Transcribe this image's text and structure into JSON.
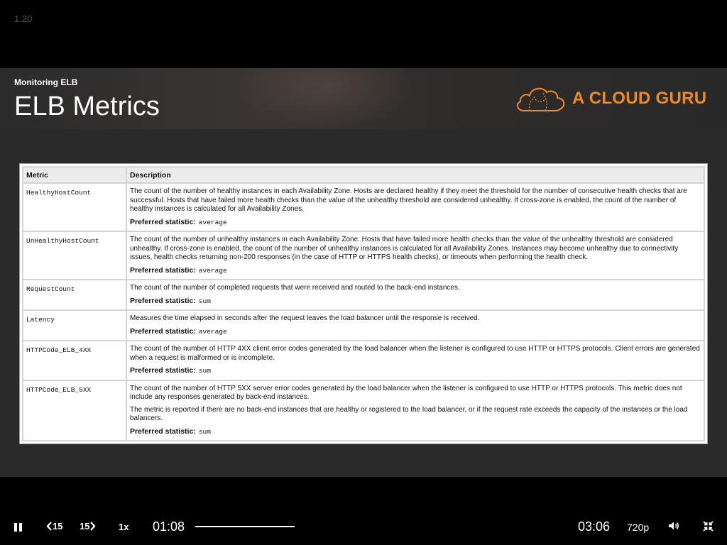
{
  "player": {
    "version": "1.20",
    "skip_back_label": "15",
    "skip_forward_label": "15",
    "speed": "1x",
    "current_time": "01:08",
    "duration": "03:06",
    "quality": "720p",
    "progress_fraction": 0.367
  },
  "slide": {
    "subtitle": "Monitoring ELB",
    "title": "ELB Metrics",
    "logo_text": "A CLOUD GURU",
    "brand_color": "#f08a24",
    "table": {
      "headers": [
        "Metric",
        "Description"
      ],
      "stat_label": "Preferred statistic:",
      "rows": [
        {
          "metric": "HealthyHostCount",
          "desc": "The count of the number of healthy instances in each Availability Zone. Hosts are declared healthy if they meet the threshold for the number of consecutive health checks that are successful. Hosts that have failed more health checks than the value of the unhealthy threshold are considered unhealthy. If cross-zone is enabled, the count of the number of healthy instances is calculated for all Availability Zones.",
          "desc2": "",
          "stat": "average"
        },
        {
          "metric": "UnHealthyHostCount",
          "desc": "The count of the number of unhealthy instances in each Availability Zone. Hosts that have failed more health checks than the value of the unhealthy threshold are considered unhealthy. If cross-zone is enabled, the count of the number of unhealthy instances is calculated for all Availability Zones. Instances may become unhealthy due to connectivity issues, health checks returning non-200 responses (in the case of HTTP or HTTPS health checks), or timeouts when performing the health check.",
          "desc2": "",
          "stat": "average"
        },
        {
          "metric": "RequestCount",
          "desc": "The count of the number of completed requests that were received and routed to the back-end instances.",
          "desc2": "",
          "stat": "sum"
        },
        {
          "metric": "Latency",
          "desc": "Measures the time elapsed in seconds after the request leaves the load balancer until the response is received.",
          "desc2": "",
          "stat": "average"
        },
        {
          "metric": "HTTPCode_ELB_4XX",
          "desc": "The count of the number of HTTP 4XX client error codes generated by the load balancer when the listener is configured to use HTTP or HTTPS protocols. Client errors are generated when a request is malformed or is incomplete.",
          "desc2": "",
          "stat": "sum"
        },
        {
          "metric": "HTTPCode_ELB_5XX",
          "desc": "The count of the number of HTTP 5XX server error codes generated by the load balancer when the listener is configured to use HTTP or HTTPS protocols. This metric does not include any responses generated by back-end instances.",
          "desc2": "The metric is reported if there are no back-end instances that are healthy or registered to the load balancer, or if the request rate exceeds the capacity of the instances or the load balancers.",
          "stat": "sum"
        }
      ]
    }
  },
  "icons": {
    "play_pause": "pause-icon",
    "skip_back": "chevron-left-icon",
    "skip_forward": "chevron-right-icon",
    "volume": "volume-icon",
    "exit_fullscreen": "exit-fullscreen-icon",
    "logo": "cloud-logo-icon"
  }
}
